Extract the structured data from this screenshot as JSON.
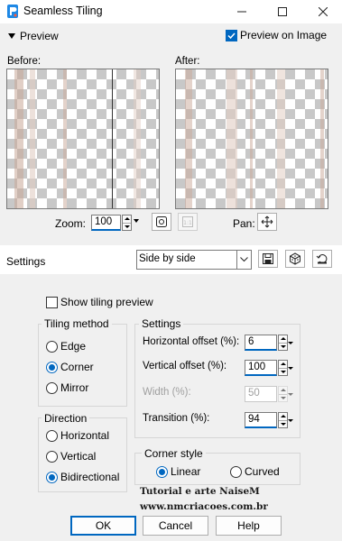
{
  "window": {
    "title": "Seamless Tiling"
  },
  "preview": {
    "section_label": "Preview",
    "preview_on_image_label": "Preview on Image",
    "preview_on_image_checked": true,
    "before_label": "Before:",
    "after_label": "After:",
    "zoom_label": "Zoom:",
    "zoom_value": "100",
    "pan_label": "Pan:"
  },
  "settings_bar": {
    "label": "Settings",
    "preset_value": "Side by side"
  },
  "show_tiling_preview": {
    "label": "Show tiling preview",
    "checked": false
  },
  "tiling_method": {
    "title": "Tiling method",
    "options": [
      "Edge",
      "Corner",
      "Mirror"
    ],
    "selected": "Corner"
  },
  "direction": {
    "title": "Direction",
    "options": [
      "Horizontal",
      "Vertical",
      "Bidirectional"
    ],
    "selected": "Bidirectional"
  },
  "settings": {
    "title": "Settings",
    "horizontal_offset_label": "Horizontal offset (%):",
    "horizontal_offset_value": "6",
    "vertical_offset_label": "Vertical offset (%):",
    "vertical_offset_value": "100",
    "width_label": "Width (%):",
    "width_value": "50",
    "transition_label": "Transition (%):",
    "transition_value": "94"
  },
  "corner_style": {
    "title": "Corner style",
    "options": [
      "Linear",
      "Curved"
    ],
    "selected": "Linear"
  },
  "watermark": {
    "line1": "Tutorial e arte NaiseM",
    "line2": "www.nmcriacoes.com.br"
  },
  "buttons": {
    "ok": "OK",
    "cancel": "Cancel",
    "help": "Help"
  },
  "colors": {
    "accent": "#0067c0",
    "panel": "#f0f0f0",
    "checker": "#c8c8c8",
    "stripe": "#c9a897"
  }
}
